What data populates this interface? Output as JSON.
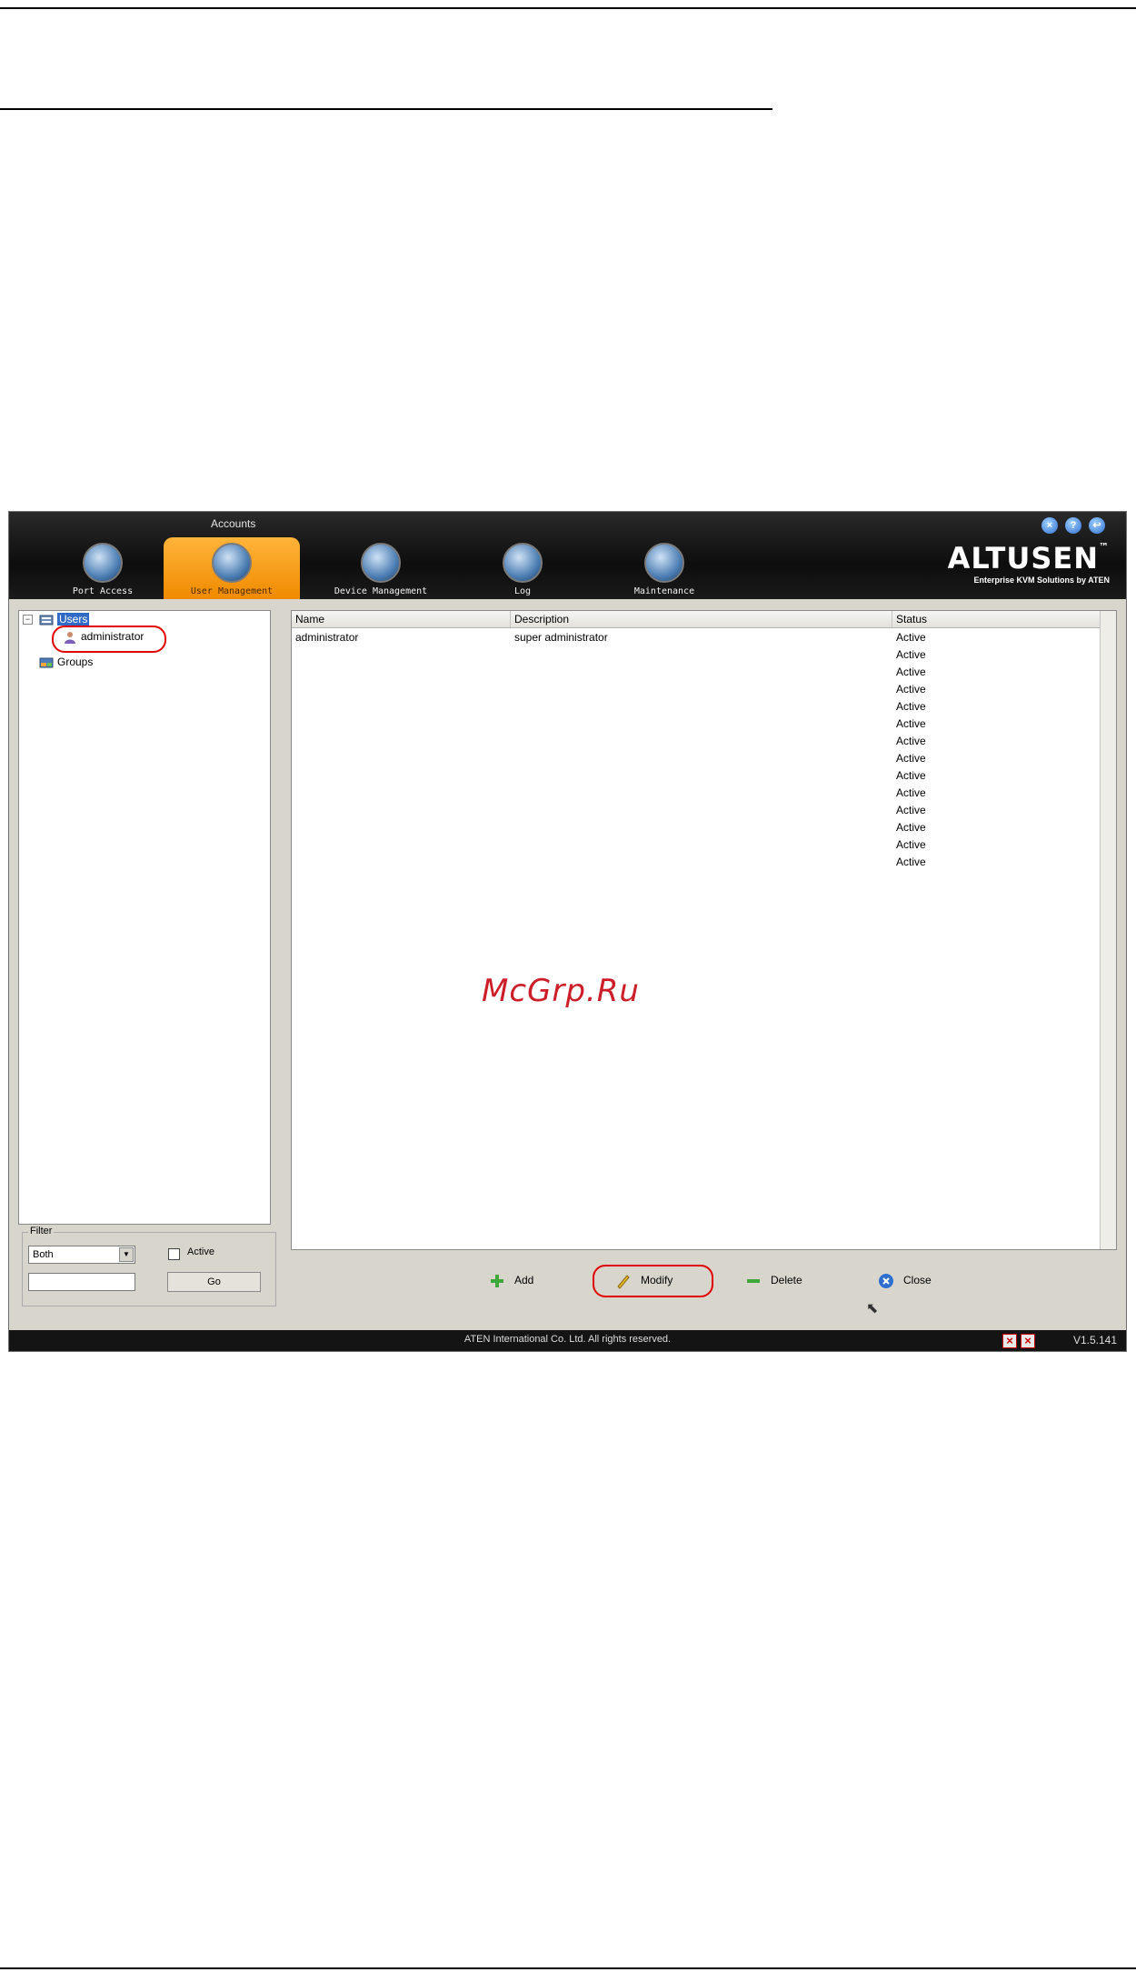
{
  "window": {
    "title": "Accounts",
    "controls": [
      "close-icon",
      "help-icon",
      "logout-icon"
    ]
  },
  "nav_tabs": [
    {
      "label": "Port Access",
      "icon": "port-access-icon",
      "active": false
    },
    {
      "label": "User Management",
      "icon": "user-management-icon",
      "active": true
    },
    {
      "label": "Device Management",
      "icon": "device-management-icon",
      "active": false
    },
    {
      "label": "Log",
      "icon": "log-icon",
      "active": false
    },
    {
      "label": "Maintenance",
      "icon": "maintenance-icon",
      "active": false
    }
  ],
  "brand": {
    "logo": "ALTUSEN",
    "trademark": "™",
    "tagline": "Enterprise KVM Solutions by ATEN"
  },
  "tree": {
    "expander": "⊟",
    "users": "Users",
    "administrator": "administrator",
    "groups": "Groups"
  },
  "filter": {
    "legend": "Filter",
    "select_value": "Both",
    "active_label": "Active",
    "input_value": "",
    "go_label": "Go"
  },
  "table": {
    "columns": [
      "Name",
      "Description",
      "Status"
    ],
    "rows": [
      {
        "name": "administrator",
        "description": "super administrator",
        "status": "Active"
      },
      {
        "name": "",
        "description": "",
        "status": "Active"
      },
      {
        "name": "",
        "description": "",
        "status": "Active"
      },
      {
        "name": "",
        "description": "",
        "status": "Active"
      },
      {
        "name": "",
        "description": "",
        "status": "Active"
      },
      {
        "name": "",
        "description": "",
        "status": "Active"
      },
      {
        "name": "",
        "description": "",
        "status": "Active"
      },
      {
        "name": "",
        "description": "",
        "status": "Active"
      },
      {
        "name": "",
        "description": "",
        "status": "Active"
      },
      {
        "name": "",
        "description": "",
        "status": "Active"
      },
      {
        "name": "",
        "description": "",
        "status": "Active"
      },
      {
        "name": "",
        "description": "",
        "status": "Active"
      },
      {
        "name": "",
        "description": "",
        "status": "Active"
      },
      {
        "name": "",
        "description": "",
        "status": "Active"
      }
    ]
  },
  "actions": {
    "add": "Add",
    "modify": "Modify",
    "delete": "Delete",
    "close": "Close"
  },
  "status_bar": {
    "copyright": "ATEN International Co. Ltd. All rights reserved.",
    "version": "V1.5.141"
  },
  "watermark": "McGrp.Ru",
  "colors": {
    "active_tab": "#f59a10",
    "highlight_oval": "#e00000",
    "selection": "#316ac5"
  }
}
